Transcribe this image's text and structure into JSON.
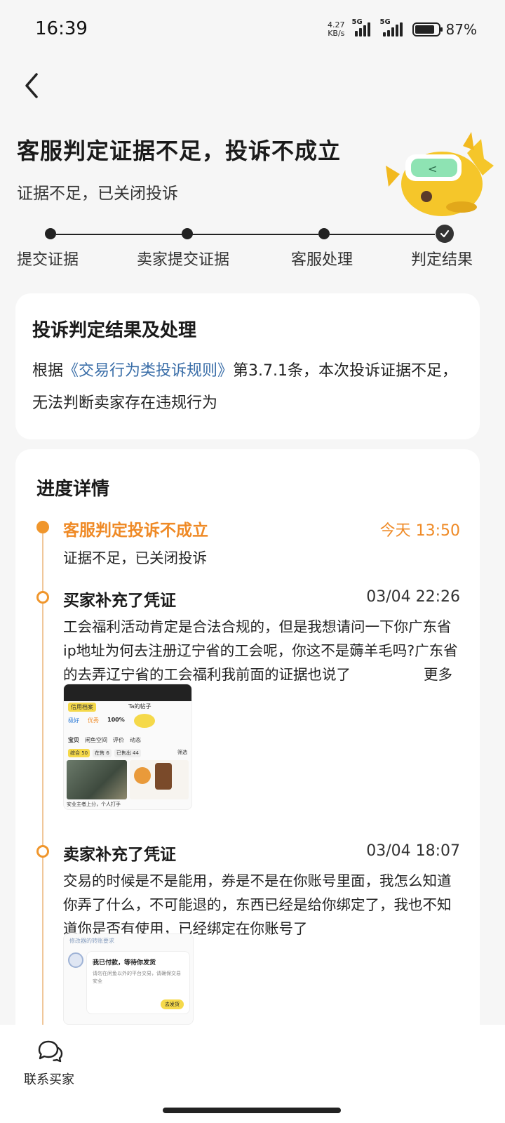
{
  "status_bar": {
    "time": "16:39",
    "net_speed_value": "4.27",
    "net_speed_unit": "KB/s",
    "signal1_label": "5G",
    "signal2_label": "5G",
    "battery_percent": "87%",
    "battery_level": 0.87
  },
  "header": {
    "back_icon": "chevron-left-icon",
    "title": "客服判定证据不足，投诉不成立",
    "subtitle": "证据不足，已关闭投诉"
  },
  "stepper": {
    "steps": [
      {
        "label": "提交证据"
      },
      {
        "label": "卖家提交证据"
      },
      {
        "label": "客服处理"
      },
      {
        "label": "判定结果"
      }
    ]
  },
  "result_card": {
    "title": "投诉判定结果及处理",
    "body_prefix": "根据",
    "rule_link": "《交易行为类投诉规则》",
    "body_suffix": "第3.7.1条，本次投诉证据不足，无法判断卖家存在违规行为"
  },
  "progress": {
    "title": "进度详情",
    "items": [
      {
        "title": "客服判定投诉不成立",
        "time": "今天 13:50",
        "text": "证据不足，已关闭投诉"
      },
      {
        "title": "买家补充了凭证",
        "time": "03/04 22:26",
        "text": "工会福利活动肯定是合法合规的，但是我想请问一下你广东省ip地址为何去注册辽宁省的工会呢，你这不是薅羊毛吗?广东省的去弄辽宁省的工会福利我前面的证据也说了",
        "more": "更多"
      },
      {
        "title": "卖家补充了凭证",
        "time": "03/04 18:07",
        "text": "交易的时候是不是能用，券是不是在你账号里面，我怎么知道你弄了什么，不可能退的，东西已经是给你绑定了，我也不知道你是否有使用，已经绑定在你账号了"
      }
    ]
  },
  "thumb1": {
    "tab_label": "信用档案",
    "seller_name": "Ta的帖子",
    "rating1": "极好",
    "rating2": "优秀",
    "rating3": "100%",
    "tabs": [
      "宝贝",
      "闲鱼空间",
      "评价",
      "动态"
    ],
    "filters": [
      "综合 50",
      "在售 6",
      "已售出 44"
    ],
    "filter_right": "筛选",
    "caption": "安业主者上分，个人打手"
  },
  "thumb2": {
    "top_text": "修改器的转账要求",
    "msg_title": "我已付款，等待你发货",
    "msg_body": "请勿在闲鱼以外的平台交易，请确保交易安全",
    "msg_button": "去发货"
  },
  "bottom": {
    "contact_icon": "chat-bubbles-icon",
    "contact_label": "联系买家"
  }
}
